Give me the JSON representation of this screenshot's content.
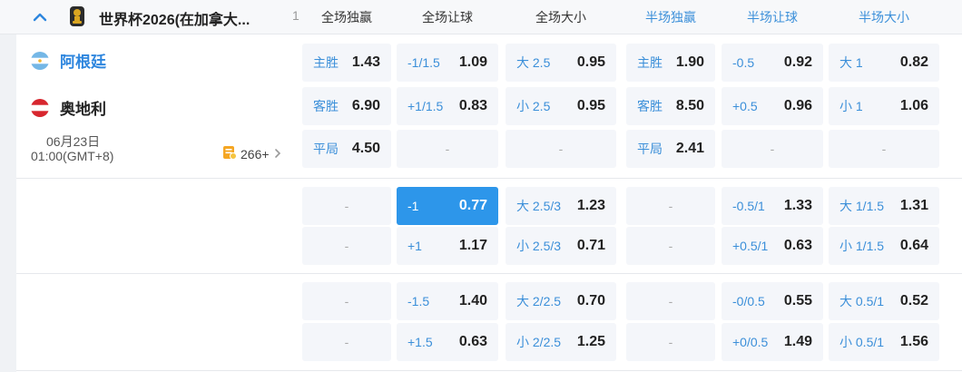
{
  "header": {
    "title": "世界杯2026(在加拿大...",
    "count": "1",
    "columns": [
      {
        "label": "全场独赢",
        "kind": "full"
      },
      {
        "label": "全场让球",
        "kind": "full"
      },
      {
        "label": "全场大小",
        "kind": "full"
      },
      {
        "label": "半场独赢",
        "kind": "half"
      },
      {
        "label": "半场让球",
        "kind": "half"
      },
      {
        "label": "半场大小",
        "kind": "half"
      }
    ]
  },
  "match": {
    "home": "阿根廷",
    "away": "奥地利",
    "date": "06月23日",
    "time": "01:00(GMT+8)",
    "more_markets": "266+"
  },
  "colors": {
    "accent": "#3b8fd9",
    "selected": "#2d96ea",
    "cell_bg": "#f4f6fa"
  },
  "odds_rows": [
    [
      {
        "label": "主胜",
        "odd": "1.43"
      },
      {
        "label": "-1/1.5",
        "odd": "1.09"
      },
      {
        "label": "大 2.5",
        "odd": "0.95"
      },
      {
        "label": "主胜",
        "odd": "1.90"
      },
      {
        "label": "-0.5",
        "odd": "0.92"
      },
      {
        "label": "大 1",
        "odd": "0.82"
      }
    ],
    [
      {
        "label": "客胜",
        "odd": "6.90"
      },
      {
        "label": "+1/1.5",
        "odd": "0.83"
      },
      {
        "label": "小 2.5",
        "odd": "0.95"
      },
      {
        "label": "客胜",
        "odd": "8.50"
      },
      {
        "label": "+0.5",
        "odd": "0.96"
      },
      {
        "label": "小 1",
        "odd": "1.06"
      }
    ],
    [
      {
        "label": "平局",
        "odd": "4.50"
      },
      {
        "empty": "-"
      },
      {
        "empty": "-"
      },
      {
        "label": "平局",
        "odd": "2.41"
      },
      {
        "empty": "-"
      },
      {
        "empty": "-"
      }
    ],
    [
      {
        "empty": "-"
      },
      {
        "label": "-1",
        "odd": "0.77",
        "selected": true
      },
      {
        "label": "大 2.5/3",
        "odd": "1.23"
      },
      {
        "empty": "-"
      },
      {
        "label": "-0.5/1",
        "odd": "1.33"
      },
      {
        "label": "大 1/1.5",
        "odd": "1.31"
      }
    ],
    [
      {
        "empty": "-"
      },
      {
        "label": "+1",
        "odd": "1.17"
      },
      {
        "label": "小 2.5/3",
        "odd": "0.71"
      },
      {
        "empty": "-"
      },
      {
        "label": "+0.5/1",
        "odd": "0.63"
      },
      {
        "label": "小 1/1.5",
        "odd": "0.64"
      }
    ],
    [
      {
        "empty": "-"
      },
      {
        "label": "-1.5",
        "odd": "1.40"
      },
      {
        "label": "大 2/2.5",
        "odd": "0.70"
      },
      {
        "empty": "-"
      },
      {
        "label": "-0/0.5",
        "odd": "0.55"
      },
      {
        "label": "大 0.5/1",
        "odd": "0.52"
      }
    ],
    [
      {
        "empty": "-"
      },
      {
        "label": "+1.5",
        "odd": "0.63"
      },
      {
        "label": "小 2/2.5",
        "odd": "1.25"
      },
      {
        "empty": "-"
      },
      {
        "label": "+0/0.5",
        "odd": "1.49"
      },
      {
        "label": "小 0.5/1",
        "odd": "1.56"
      }
    ]
  ]
}
